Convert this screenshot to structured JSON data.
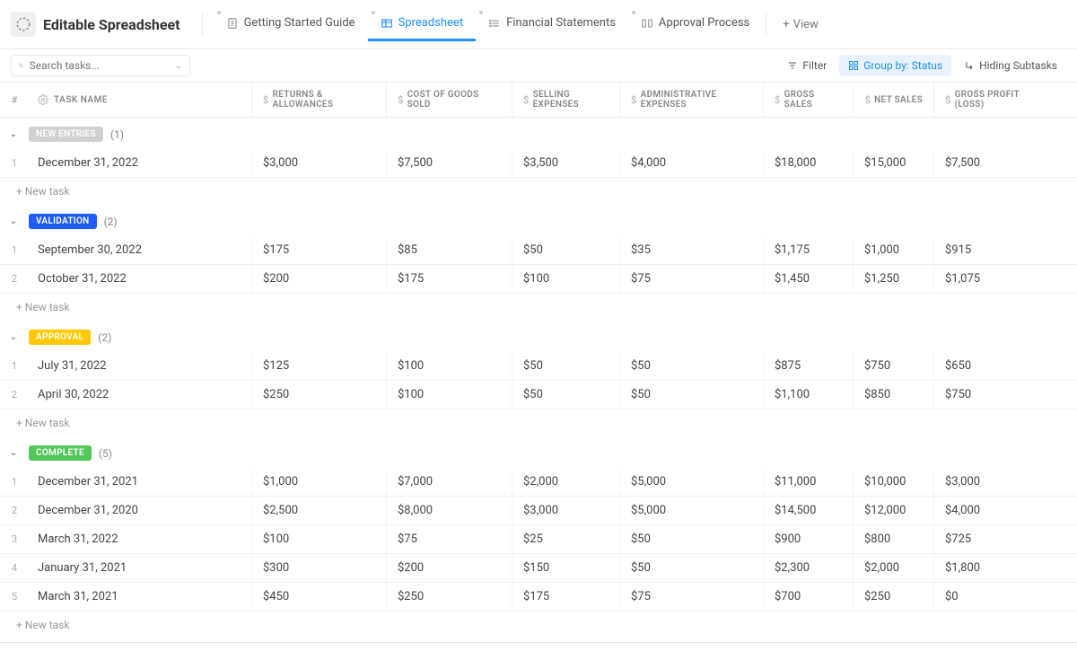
{
  "header": {
    "title": "Editable Spreadsheet",
    "tabs": [
      {
        "label": "Getting Started Guide",
        "active": false
      },
      {
        "label": "Spreadsheet",
        "active": true
      },
      {
        "label": "Financial Statements",
        "active": false
      },
      {
        "label": "Approval Process",
        "active": false
      }
    ],
    "add_view": "View"
  },
  "toolbar": {
    "search_placeholder": "Search tasks...",
    "filter": "Filter",
    "group_by": "Group by: Status",
    "hiding": "Hiding Subtasks"
  },
  "columns": {
    "num": "#",
    "name": "TASK NAME",
    "returns": "RETURNS & ALLOWANCES",
    "cogs": "COST OF GOODS SOLD",
    "selling": "SELLING EXPENSES",
    "admin": "ADMINISTRATIVE EXPENSES",
    "gross_sales": "GROSS SALES",
    "net_sales": "NET SALES",
    "gross_profit": "GROSS PROFIT (LOSS)"
  },
  "groups": [
    {
      "status": "NEW ENTRIES",
      "pill_class": "pill-new",
      "count": "(1)",
      "rows": [
        {
          "n": "1",
          "name": "December 31, 2022",
          "returns": "$3,000",
          "cogs": "$7,500",
          "selling": "$3,500",
          "admin": "$4,000",
          "gross_sales": "$18,000",
          "net_sales": "$15,000",
          "gross_profit": "$7,500"
        }
      ]
    },
    {
      "status": "VALIDATION",
      "pill_class": "pill-validation",
      "count": "(2)",
      "rows": [
        {
          "n": "1",
          "name": "September 30, 2022",
          "returns": "$175",
          "cogs": "$85",
          "selling": "$50",
          "admin": "$35",
          "gross_sales": "$1,175",
          "net_sales": "$1,000",
          "gross_profit": "$915"
        },
        {
          "n": "2",
          "name": "October 31, 2022",
          "returns": "$200",
          "cogs": "$175",
          "selling": "$100",
          "admin": "$75",
          "gross_sales": "$1,450",
          "net_sales": "$1,250",
          "gross_profit": "$1,075"
        }
      ]
    },
    {
      "status": "APPROVAL",
      "pill_class": "pill-approval",
      "count": "(2)",
      "rows": [
        {
          "n": "1",
          "name": "July 31, 2022",
          "returns": "$125",
          "cogs": "$100",
          "selling": "$50",
          "admin": "$50",
          "gross_sales": "$875",
          "net_sales": "$750",
          "gross_profit": "$650"
        },
        {
          "n": "2",
          "name": "April 30, 2022",
          "returns": "$250",
          "cogs": "$100",
          "selling": "$50",
          "admin": "$50",
          "gross_sales": "$1,100",
          "net_sales": "$850",
          "gross_profit": "$750"
        }
      ]
    },
    {
      "status": "COMPLETE",
      "pill_class": "pill-complete",
      "count": "(5)",
      "rows": [
        {
          "n": "1",
          "name": "December 31, 2021",
          "returns": "$1,000",
          "cogs": "$7,000",
          "selling": "$2,000",
          "admin": "$5,000",
          "gross_sales": "$11,000",
          "net_sales": "$10,000",
          "gross_profit": "$3,000"
        },
        {
          "n": "2",
          "name": "December 31, 2020",
          "returns": "$2,500",
          "cogs": "$8,000",
          "selling": "$3,000",
          "admin": "$5,000",
          "gross_sales": "$14,500",
          "net_sales": "$12,000",
          "gross_profit": "$4,000"
        },
        {
          "n": "3",
          "name": "March 31, 2022",
          "returns": "$100",
          "cogs": "$75",
          "selling": "$25",
          "admin": "$50",
          "gross_sales": "$900",
          "net_sales": "$800",
          "gross_profit": "$725"
        },
        {
          "n": "4",
          "name": "January 31, 2021",
          "returns": "$300",
          "cogs": "$200",
          "selling": "$150",
          "admin": "$50",
          "gross_sales": "$2,300",
          "net_sales": "$2,000",
          "gross_profit": "$1,800"
        },
        {
          "n": "5",
          "name": "March 31, 2021",
          "returns": "$450",
          "cogs": "$250",
          "selling": "$175",
          "admin": "$75",
          "gross_sales": "$700",
          "net_sales": "$250",
          "gross_profit": "$0"
        }
      ]
    }
  ],
  "new_task": "+ New task"
}
